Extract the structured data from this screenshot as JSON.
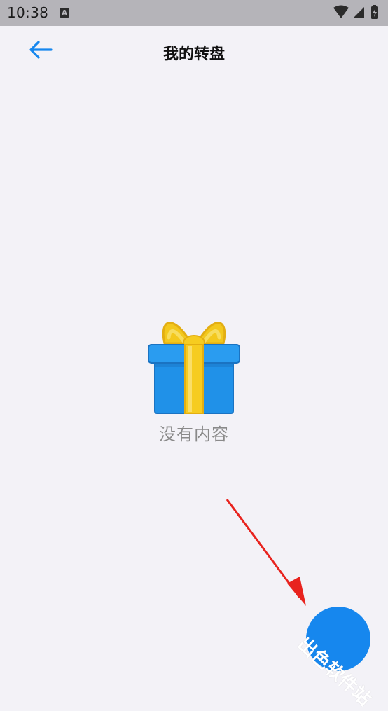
{
  "status_bar": {
    "time": "10:38",
    "notification_icon": "a-notification-icon",
    "icons": [
      "wifi-icon",
      "signal-icon",
      "battery-charging-icon"
    ]
  },
  "header": {
    "back_icon": "arrow-left-icon",
    "title": "我的转盘"
  },
  "empty_state": {
    "icon": "gift-box-icon",
    "message": "没有内容"
  },
  "watermark": {
    "text": "出色软件站"
  },
  "colors": {
    "accent": "#1687ee",
    "background": "#f3f2f7",
    "status_bar": "#b5b4b9",
    "annotation_arrow": "#e8231e"
  }
}
